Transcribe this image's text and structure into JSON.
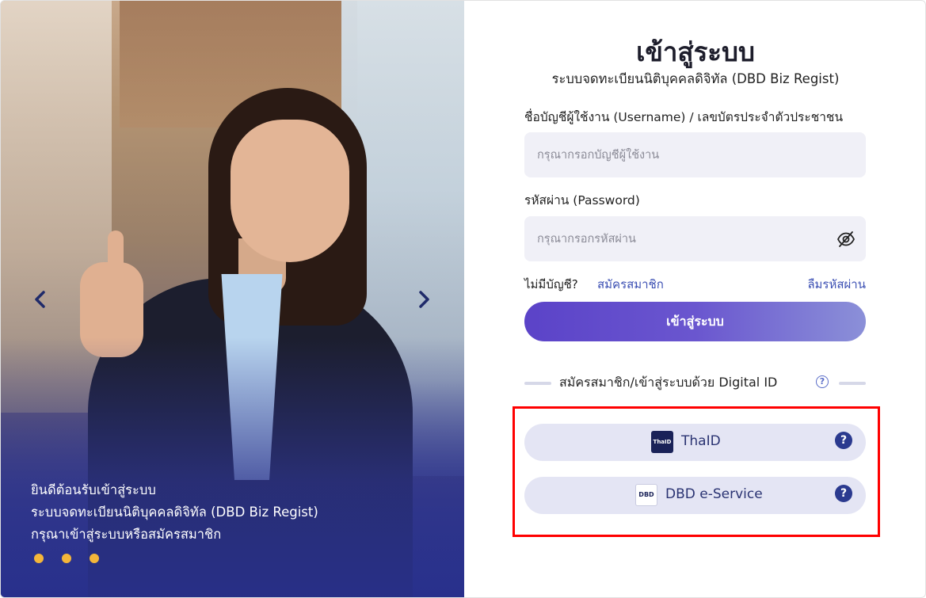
{
  "hero": {
    "prev_icon": "chevron-left-icon",
    "next_icon": "chevron-right-icon",
    "welcome_line1": "ยินดีต้อนรับเข้าสู่ระบบ",
    "welcome_line2": "ระบบจดทะเบียนนิติบุคคลดิจิทัล (DBD Biz Regist)",
    "welcome_line3": "กรุณาเข้าสู่ระบบหรือสมัครสมาชิก",
    "accent": "#f4b63a"
  },
  "login": {
    "title": "เข้าสู่ระบบ",
    "subtitle": "ระบบจดทะเบียนนิติบุคคลดิจิทัล (DBD Biz Regist)",
    "username_label": "ชื่อบัญชีผู้ใช้งาน (Username) / เลขบัตรประจำตัวประชาชน",
    "username_placeholder": "กรุณากรอกบัญชีผู้ใช้งาน",
    "password_label": "รหัสผ่าน (Password)",
    "password_placeholder": "กรุณากรอกรหัสผ่าน",
    "password_toggle_icon": "eye-slash-icon",
    "no_account_text": "ไม่มีบัญชี?",
    "signup_link": "สมัครสมาชิก",
    "forgot_link": "ลืมรหัสผ่าน",
    "submit_label": "เข้าสู่ระบบ",
    "digital_id_heading": "สมัครสมาชิก/เข้าสู่ระบบด้วย Digital ID",
    "help_symbol": "?",
    "providers": [
      {
        "label": "ThaID",
        "logo_text": "ThaID",
        "icon": "thaid-logo-icon"
      },
      {
        "label": "DBD e-Service",
        "logo_text": "DBD",
        "icon": "dbd-logo-icon"
      }
    ],
    "colors": {
      "primary": "#5b43c8",
      "link": "#3b4fb3",
      "highlight": "#ff0000"
    }
  }
}
